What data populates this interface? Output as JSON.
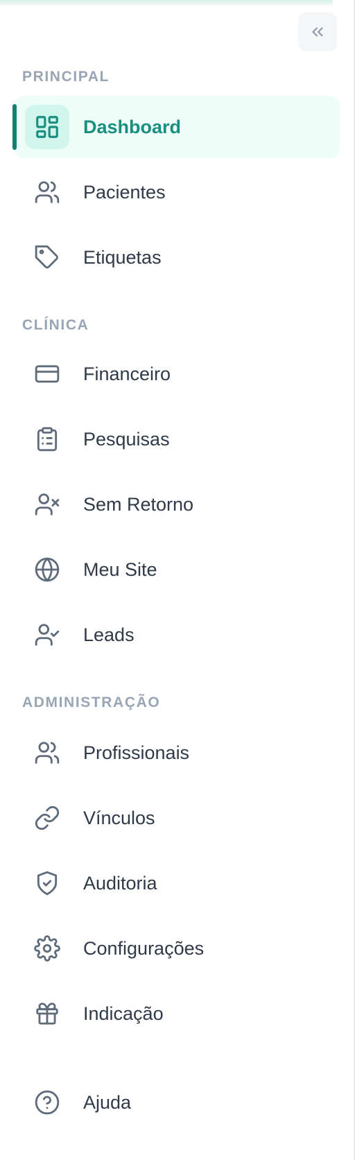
{
  "colors": {
    "accent": "#1a8f7f",
    "accent_bg": "#effdf9",
    "text": "#2f3a48",
    "section": "#9aa5b4"
  },
  "collapse": {
    "icon": "chevrons-left-icon"
  },
  "sections": {
    "principal": "PRINCIPAL",
    "clinica": "CLÍNICA",
    "administracao": "ADMINISTRAÇÃO"
  },
  "nav": {
    "dashboard": {
      "label": "Dashboard",
      "icon": "dashboard-grid-icon",
      "active": true
    },
    "pacientes": {
      "label": "Pacientes",
      "icon": "users-icon"
    },
    "etiquetas": {
      "label": "Etiquetas",
      "icon": "tag-icon"
    },
    "financeiro": {
      "label": "Financeiro",
      "icon": "credit-card-icon"
    },
    "pesquisas": {
      "label": "Pesquisas",
      "icon": "clipboard-list-icon"
    },
    "sem_retorno": {
      "label": "Sem Retorno",
      "icon": "user-x-icon"
    },
    "meu_site": {
      "label": "Meu Site",
      "icon": "globe-icon"
    },
    "leads": {
      "label": "Leads",
      "icon": "user-check-icon"
    },
    "profissionais": {
      "label": "Profissionais",
      "icon": "users-icon"
    },
    "vinculos": {
      "label": "Vínculos",
      "icon": "link-icon"
    },
    "auditoria": {
      "label": "Auditoria",
      "icon": "shield-check-icon"
    },
    "configuracoes": {
      "label": "Configurações",
      "icon": "gear-icon"
    },
    "indicacao": {
      "label": "Indicação",
      "icon": "gift-icon"
    },
    "ajuda": {
      "label": "Ajuda",
      "icon": "help-circle-icon"
    }
  }
}
